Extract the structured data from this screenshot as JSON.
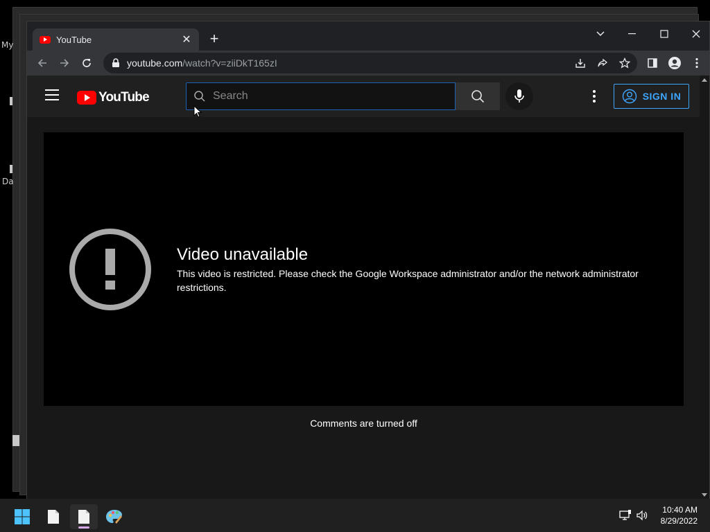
{
  "desktop": {
    "label_1": "My",
    "label_2": "Da"
  },
  "browser": {
    "tab_title": "YouTube",
    "tab_close": "✕",
    "new_tab": "+",
    "url_host": "youtube.com",
    "url_path": "/watch?v=ziiDkT165zI"
  },
  "youtube": {
    "logo_text": "YouTube",
    "search_placeholder": "Search",
    "sign_in_label": "SIGN IN",
    "error_title": "Video unavailable",
    "error_message": "This video is restricted. Please check the Google Workspace administrator and/or the network administrator restrictions.",
    "comments_status": "Comments are turned off"
  },
  "taskbar": {
    "time": "10:40 AM",
    "date": "8/29/2022"
  },
  "colors": {
    "youtube_red": "#ff0000",
    "link_blue": "#3ea6ff",
    "page_bg": "#181818",
    "header_bg": "#202020"
  }
}
